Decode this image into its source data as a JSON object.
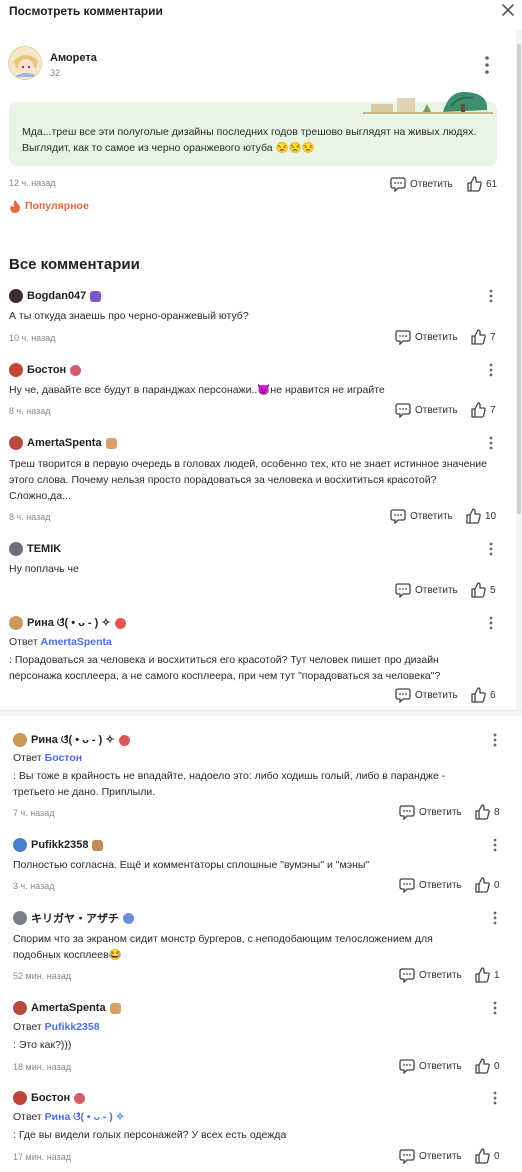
{
  "header": {
    "title": "Посмотреть комментарии",
    "close_icon": "close-icon"
  },
  "main": {
    "author": "Аморета",
    "level": "32",
    "text": "Мда...треш все эти полуголые дизайны последних годов трешово выглядят на живых людях. Выглядит, как то самое из черно оранжевого ютуба 😒😒😒",
    "time": "12 ч. назад",
    "reply_label": "Ответить",
    "likes": "61",
    "popular_label": "Популярное"
  },
  "section_title": "Все комментарии",
  "comments": [
    {
      "author": "Bogdan047",
      "text": "А ты откуда знаешь про черно-оранжевый ютуб?",
      "time": "10 ч. назад",
      "reply_label": "Ответить",
      "likes": "7"
    },
    {
      "author": "Бостон",
      "text": "Ну че, давайте все будут в паранджах персонажи..👿не нравится не играйте",
      "time": "8 ч. назад",
      "reply_label": "Ответить",
      "likes": "7"
    },
    {
      "author": "AmertaSpenta",
      "text": "Треш творится в первую очередь в головах людей, особенно тех, кто не знает истинное значение этого слова. Почему нельзя просто порадоваться за человека и восхититься красотой? Сложно,да...",
      "time": "8 ч. назад",
      "reply_label": "Ответить",
      "likes": "10"
    },
    {
      "author": "TEMIK",
      "text": "Ну поплачь че",
      "time": "",
      "reply_label": "Ответить",
      "likes": "5"
    },
    {
      "author": "Рина ଓ̊( • ᴗ - ) ✧",
      "reply_prefix": "Ответ",
      "reply_to": "AmertaSpenta",
      "text": ": Порадоваться за человека и восхититься его красотой? Тут человек пишет про дизайн персонажа косплеера, а не самого косплеера, при чем тут \"порадоваться за человека\"?",
      "time": "",
      "reply_label": "Ответить",
      "likes": "6"
    },
    {
      "author": "Рина ଓ̊( • ᴗ - ) ✧",
      "reply_prefix": "Ответ",
      "reply_to": "Бостон",
      "text": ": Вы тоже в крайность не впадайте, надоело это: либо ходишь голый, либо в парандже - третьего не дано. Приплыли.",
      "time": "7 ч. назад",
      "reply_label": "Ответить",
      "likes": "8"
    },
    {
      "author": "Pufikk2358",
      "text": "Полностью согласна. Ещё и комментаторы сплошные \"вумэны\" и \"мэны\"",
      "time": "3 ч. назад",
      "reply_label": "Ответить",
      "likes": "0"
    },
    {
      "author": "キリガヤ・アザチ",
      "text": "Спорим что за экраном сидит монстр бургеров, с неподобающим телосложением для подобных косплеев😂",
      "time": "52 мин. назад",
      "reply_label": "Ответить",
      "likes": "1"
    },
    {
      "author": "AmertaSpenta",
      "reply_prefix": "Ответ",
      "reply_to": "Pufikk2358",
      "text": ": Это как?)))",
      "time": "18 мин. назад",
      "reply_label": "Ответить",
      "likes": "0"
    },
    {
      "author": "Бостон",
      "reply_prefix": "Ответ",
      "reply_to": "Рина ଓ̊( • ᴗ - ) ✧",
      "text": ": Где вы видели голых персонажей? У всех есть одежда",
      "time": "17 мин. назад",
      "reply_label": "Ответить",
      "likes": "0"
    }
  ],
  "colors": {
    "accent_link": "#4a6de5",
    "popular_orange": "#e6683c",
    "bubble_bg": "#e8f4e4"
  }
}
